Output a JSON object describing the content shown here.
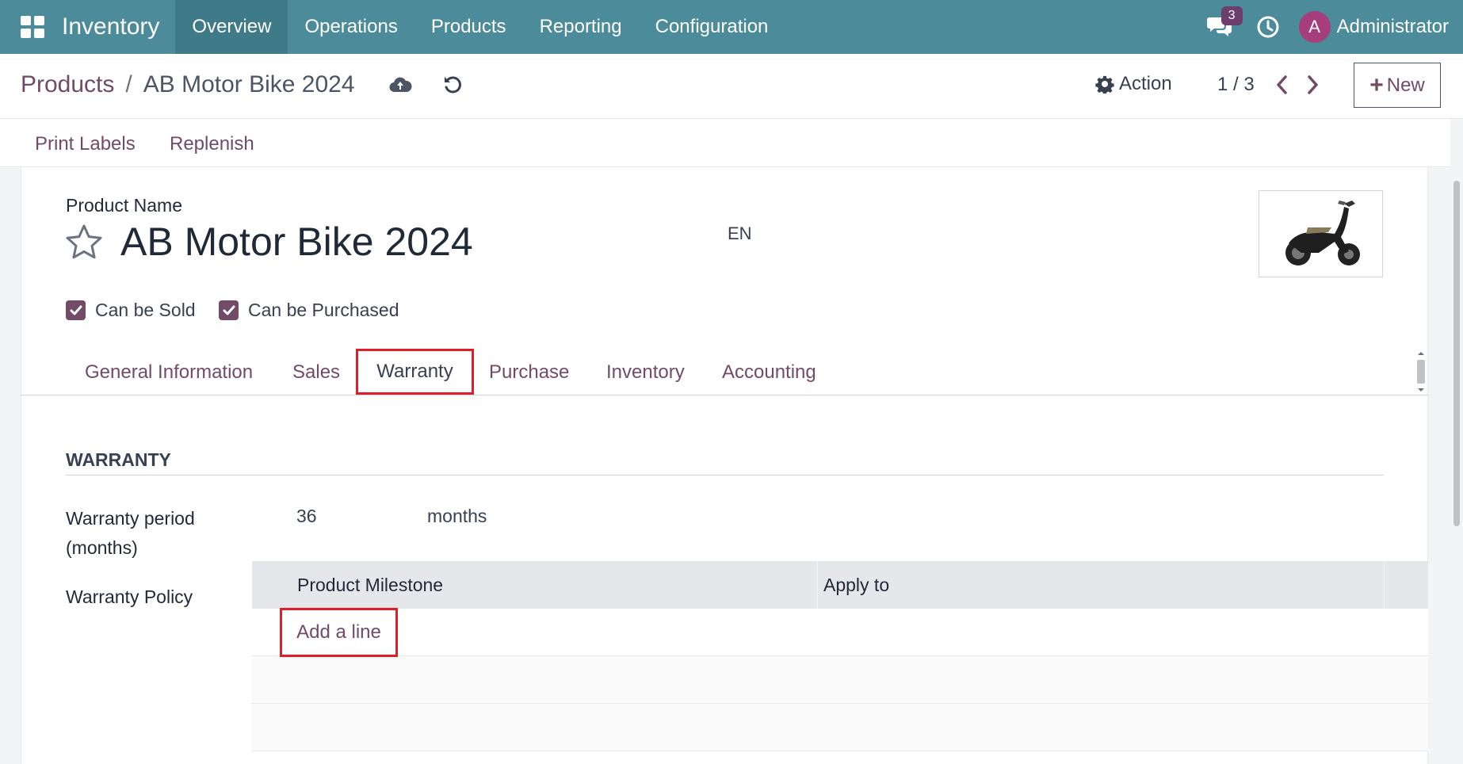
{
  "navbar": {
    "app_name": "Inventory",
    "menu": [
      "Overview",
      "Operations",
      "Products",
      "Reporting",
      "Configuration"
    ],
    "active_index": 0,
    "messages_count": "3",
    "avatar_letter": "A",
    "user_name": "Administrator"
  },
  "breadcrumb": {
    "parent": "Products",
    "separator": "/",
    "current": "AB Motor Bike 2024"
  },
  "control": {
    "action_label": "Action",
    "pager": "1 / 3",
    "new_label": "New"
  },
  "buttonbox": {
    "print_labels": "Print Labels",
    "replenish": "Replenish"
  },
  "form": {
    "product_name_label": "Product Name",
    "product_name": "AB Motor Bike 2024",
    "lang": "EN",
    "can_be_sold": {
      "label": "Can be Sold",
      "checked": true
    },
    "can_be_purchased": {
      "label": "Can be Purchased",
      "checked": true
    }
  },
  "tabs": {
    "items": [
      "General Information",
      "Sales",
      "Warranty",
      "Purchase",
      "Inventory",
      "Accounting"
    ],
    "active": "Warranty"
  },
  "warranty": {
    "section_title": "WARRANTY",
    "period_label": "Warranty period (months)",
    "period_value": "36",
    "period_unit": "months",
    "policy_label": "Warranty Policy",
    "columns": [
      "Product Milestone",
      "Apply to"
    ],
    "add_line": "Add a line"
  },
  "colors": {
    "navbar": "#4c8b99",
    "brand": "#714b67",
    "highlight": "#e11d2a"
  }
}
